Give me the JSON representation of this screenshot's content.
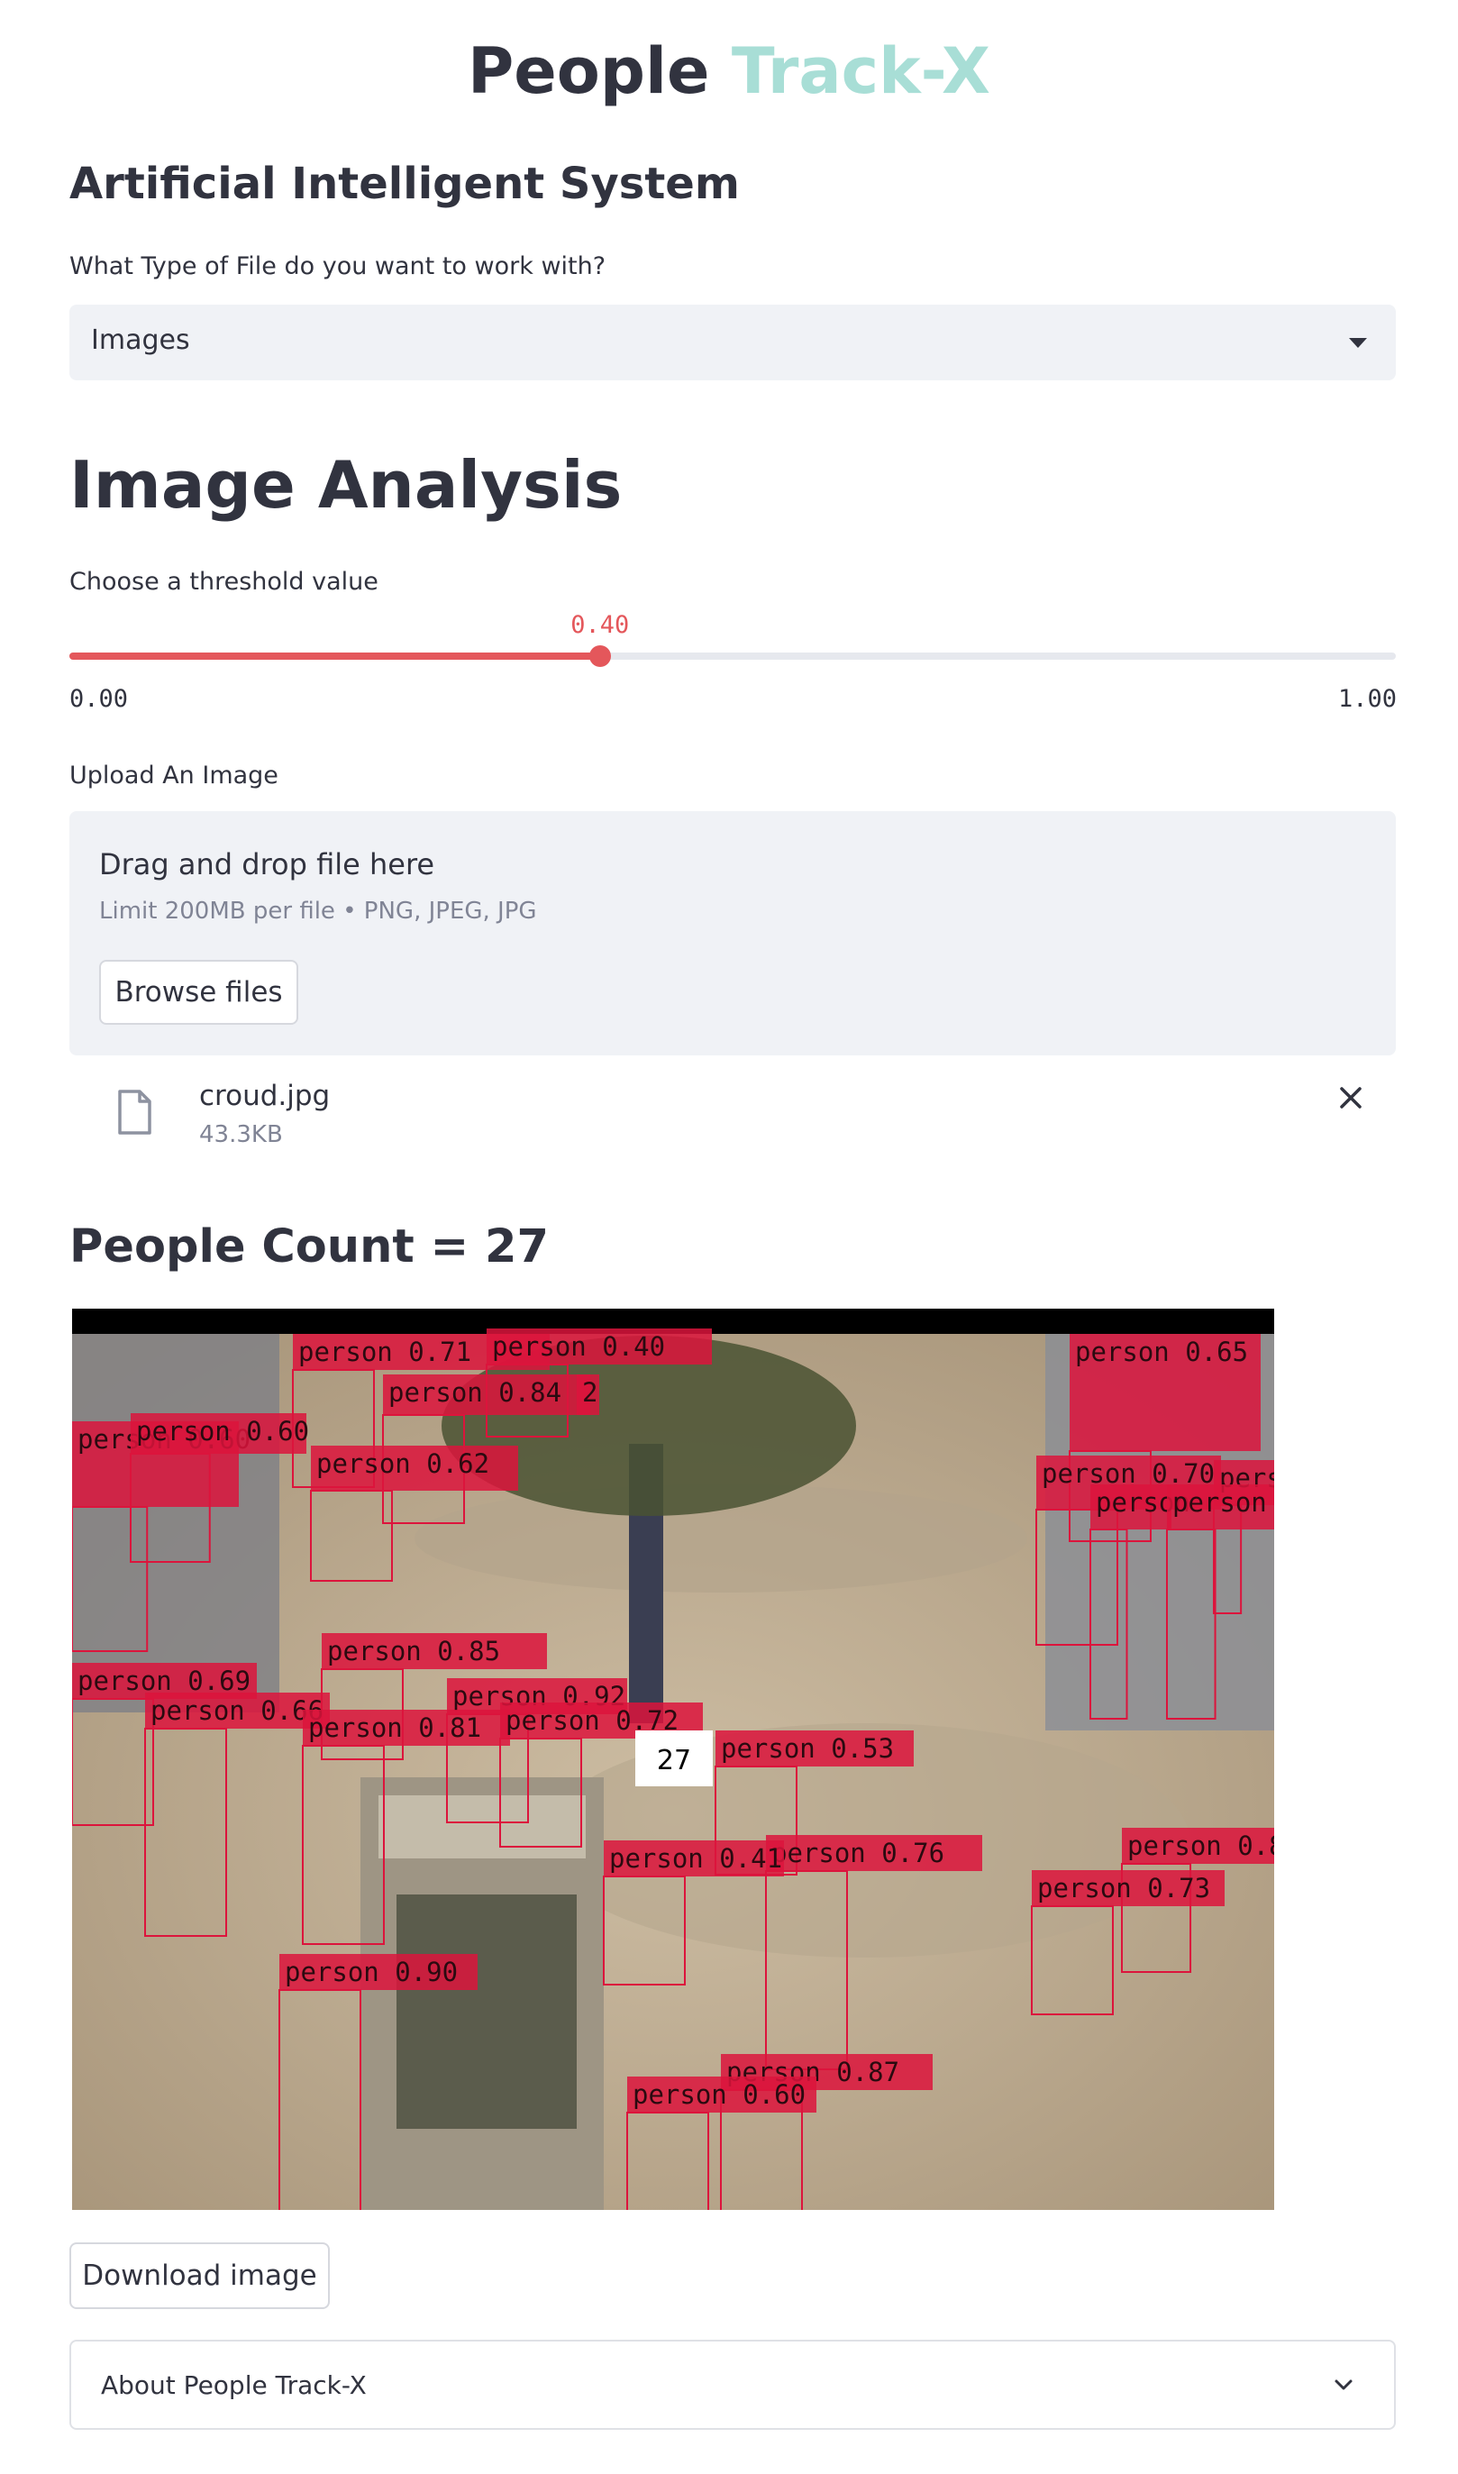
{
  "app": {
    "title_main": "People",
    "title_accent": "Track-X"
  },
  "sections": {
    "subheader": "Artificial Intelligent System",
    "file_type_label": "What Type of File do you want to work with?",
    "file_type_value": "Images",
    "analysis_heading": "Image Analysis"
  },
  "slider": {
    "label": "Choose a threshold value",
    "value_text": "0.40",
    "value": 0.4,
    "min_text": "0.00",
    "max_text": "1.00",
    "accent": "#e4575b"
  },
  "uploader": {
    "label": "Upload An Image",
    "drop_title": "Drag and drop file here",
    "drop_sub": "Limit 200MB per file • PNG, JPEG, JPG",
    "browse_label": "Browse files",
    "file_name": "croud.jpg",
    "file_size": "43.3KB"
  },
  "result": {
    "count_heading": "People Count = 27",
    "count_badge": "27",
    "detections": [
      "person 0.71",
      "person 0.40",
      "person 0.65",
      "person 0.84",
      "2",
      "person 0.60",
      "person 0.60",
      "person 0.62",
      "person 0.70",
      "pers",
      "person",
      "person",
      "person 0.85",
      "person 0.69",
      "person 0.92",
      "person 0.66",
      "person 0.81",
      "person 0.72",
      "person 0.53",
      "person 0.76",
      "person 0.8",
      "person 0.41",
      "person 0.73",
      "person 0.90",
      "person 0.87",
      "person 0.60"
    ],
    "download_label": "Download image"
  },
  "expander": {
    "label": "About People Track-X"
  },
  "colors": {
    "accent_title": "#a8ded6",
    "text": "#31333f",
    "detection_box": "#dc143c"
  }
}
